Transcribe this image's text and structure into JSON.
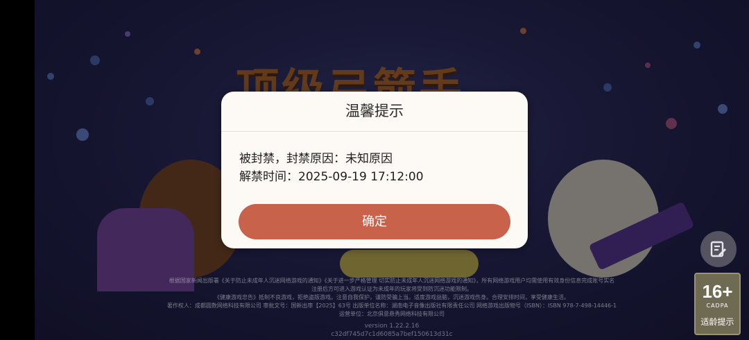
{
  "game": {
    "logo_text": "顶级弓箭手",
    "legal_lines": [
      "根据国家新闻出版署《关于防止未成年人沉迷网络游戏的通知》《关于进一步严格管理 切实防止未成年人沉迷网络游戏的通知》，所有网络游戏用户均需使用有效身份信息完成账号实名",
      "注册后方可进入游戏认证为未成年的玩家将受到防沉迷功能限制。",
      "《健康游戏忠告》抵制不良游戏，拒绝盗版游戏。注意自我保护，谨防受骗上当。适度游戏益脑，沉迷游戏伤身。合理安排时间，享受健康生活。",
      "著作权人：成都圆数网络科技有限公司 审批文号：国新出审【2025】63号 出版单位名称：湖南电子音像出版社有限责任公司 网络游戏出版物号（ISBN）：ISBN 978-7-498-14446-1",
      "运营单位：北京俱意悬秀网络科技有限公司"
    ],
    "version": "version 1.22.2.16",
    "build_hash": "c32df745d7c1d6085a7bef150613d31c"
  },
  "age_rating": {
    "rating": "16+",
    "org": "CADPA",
    "label": "适龄提示"
  },
  "icons": {
    "edit": "edit-icon"
  },
  "dialog": {
    "title": "温馨提示",
    "line1": "被封禁，封禁原因：未知原因",
    "line2": "解禁时间：2025-09-19 17:12:00",
    "confirm_label": "确定"
  },
  "colors": {
    "confirm_button": "#c8624a",
    "dialog_bg": "#fdf9f4",
    "age_badge_bg": "#6f6a52"
  }
}
